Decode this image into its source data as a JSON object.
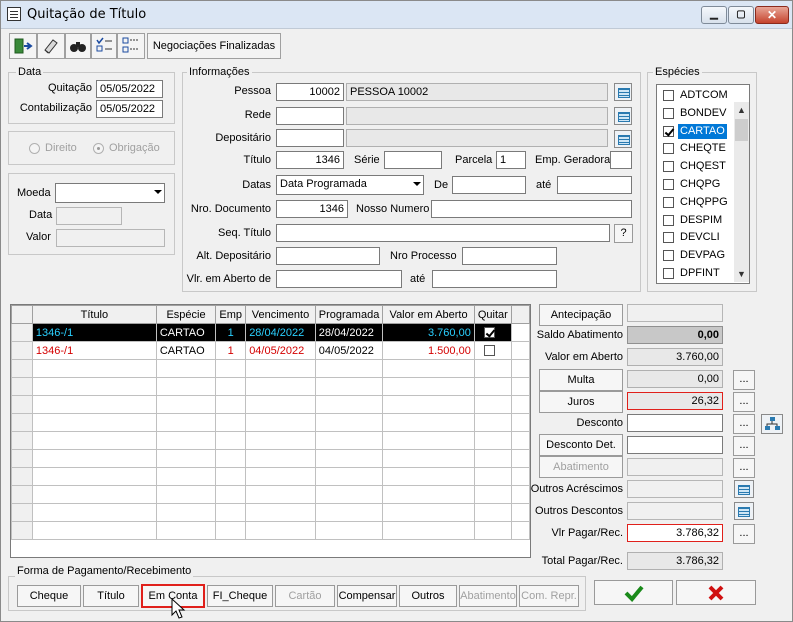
{
  "window": {
    "title": "Quitação de Título"
  },
  "toolbar": {
    "negociacoes_label": "Negociações Finalizadas"
  },
  "data": {
    "group_label": "Data",
    "quitacao_label": "Quitação",
    "quitacao_value": "05/05/2022",
    "contabilizacao_label": "Contabilização",
    "contabilizacao_value": "05/05/2022",
    "direito_label": "Direito",
    "obrigacao_label": "Obrigação",
    "moeda_label": "Moeda",
    "moeda_value": "",
    "data_label": "Data",
    "data_value": "",
    "valor_label": "Valor",
    "valor_value": ""
  },
  "info": {
    "group_label": "Informações",
    "pessoa_label": "Pessoa",
    "pessoa_code": "10002",
    "pessoa_name": "PESSOA 10002",
    "rede_label": "Rede",
    "rede_code": "",
    "rede_name": "",
    "depositario_label": "Depositário",
    "depositario_code": "",
    "depositario_name": "",
    "titulo_label": "Título",
    "titulo_value": "1346",
    "serie_label": "Série",
    "serie_value": "",
    "parcela_label": "Parcela",
    "parcela_value": "1",
    "emp_geradora_label": "Emp. Geradora",
    "emp_geradora_value": "",
    "datas_label": "Datas",
    "datas_value": "Data Programada",
    "de_label": "De",
    "de_value": "",
    "ate_label": "até",
    "ate_value": "",
    "nro_doc_label": "Nro. Documento",
    "nro_doc_value": "1346",
    "nosso_numero_label": "Nosso Numero",
    "nosso_numero_value": "",
    "seq_titulo_label": "Seq. Título",
    "seq_titulo_value": "",
    "seq_btn": "?",
    "alt_dep_label": "Alt. Depositário",
    "alt_dep_value": "",
    "nro_processo_label": "Nro Processo",
    "nro_processo_value": "",
    "vlr_aberto_label": "Vlr. em Aberto de",
    "vlr_aberto_value": "",
    "vlr_ate_label": "até",
    "vlr_ate_value": ""
  },
  "especies": {
    "group_label": "Espécies",
    "items": [
      {
        "label": "ADTCOM",
        "checked": false,
        "selected": false
      },
      {
        "label": "BONDEV",
        "checked": false,
        "selected": false
      },
      {
        "label": "CARTAO",
        "checked": true,
        "selected": true
      },
      {
        "label": "CHEQTE",
        "checked": false,
        "selected": false
      },
      {
        "label": "CHQEST",
        "checked": false,
        "selected": false
      },
      {
        "label": "CHQPG",
        "checked": false,
        "selected": false
      },
      {
        "label": "CHQPPG",
        "checked": false,
        "selected": false
      },
      {
        "label": "DESPIM",
        "checked": false,
        "selected": false
      },
      {
        "label": "DEVCLI",
        "checked": false,
        "selected": false
      },
      {
        "label": "DEVPAG",
        "checked": false,
        "selected": false
      },
      {
        "label": "DPFINT",
        "checked": false,
        "selected": false
      }
    ]
  },
  "grid": {
    "columns": [
      "Título",
      "Espécie",
      "Emp",
      "Vencimento",
      "Programada",
      "Valor em Aberto",
      "Quitar"
    ],
    "rows": [
      {
        "titulo": "1346-/1",
        "especie": "CARTAO",
        "emp": "1",
        "vencimento": "28/04/2022",
        "programada": "28/04/2022",
        "valor": "3.760,00",
        "quitar": true,
        "selected": true
      },
      {
        "titulo": "1346-/1",
        "especie": "CARTAO",
        "emp": "1",
        "vencimento": "04/05/2022",
        "programada": "04/05/2022",
        "valor": "1.500,00",
        "quitar": false,
        "selected": false
      }
    ]
  },
  "summary": {
    "antecipacao_label": "Antecipação",
    "antecipacao_value": "",
    "saldo_abatimento_label": "Saldo Abatimento",
    "saldo_abatimento_value": "0,00",
    "valor_aberto_label": "Valor em Aberto",
    "valor_aberto_value": "3.760,00",
    "multa_label": "Multa",
    "multa_value": "0,00",
    "juros_label": "Juros",
    "juros_value": "26,32",
    "desconto_label": "Desconto",
    "desconto_value": "",
    "desconto_det_label": "Desconto Det.",
    "desconto_det_value": "",
    "abatimento_label": "Abatimento",
    "abatimento_value": "",
    "outros_acrescimos_label": "Outros Acréscimos",
    "outros_acrescimos_value": "",
    "outros_descontos_label": "Outros Descontos",
    "outros_descontos_value": "",
    "vlr_pagar_label": "Vlr Pagar/Rec.",
    "vlr_pagar_value": "3.786,32",
    "total_pagar_label": "Total Pagar/Rec.",
    "total_pagar_value": "3.786,32",
    "ellipsis": "..."
  },
  "payment": {
    "group_label": "Forma de Pagamento/Recebimento",
    "cheque": "Cheque",
    "titulo": "Título",
    "em_conta": "Em Conta",
    "fi_cheque": "FI_Cheque",
    "cartao": "Cartão",
    "compensar": "Compensar",
    "outros": "Outros",
    "abatimento": "Abatimento",
    "com_repr": "Com. Repr."
  },
  "colors": {
    "confirm": "#1a8a1a",
    "cancel": "#d01010",
    "highlight": "#e0201b",
    "selection": "#0078d7",
    "row_sel_text": "#2ad0ff",
    "row_red": "#d40000"
  }
}
